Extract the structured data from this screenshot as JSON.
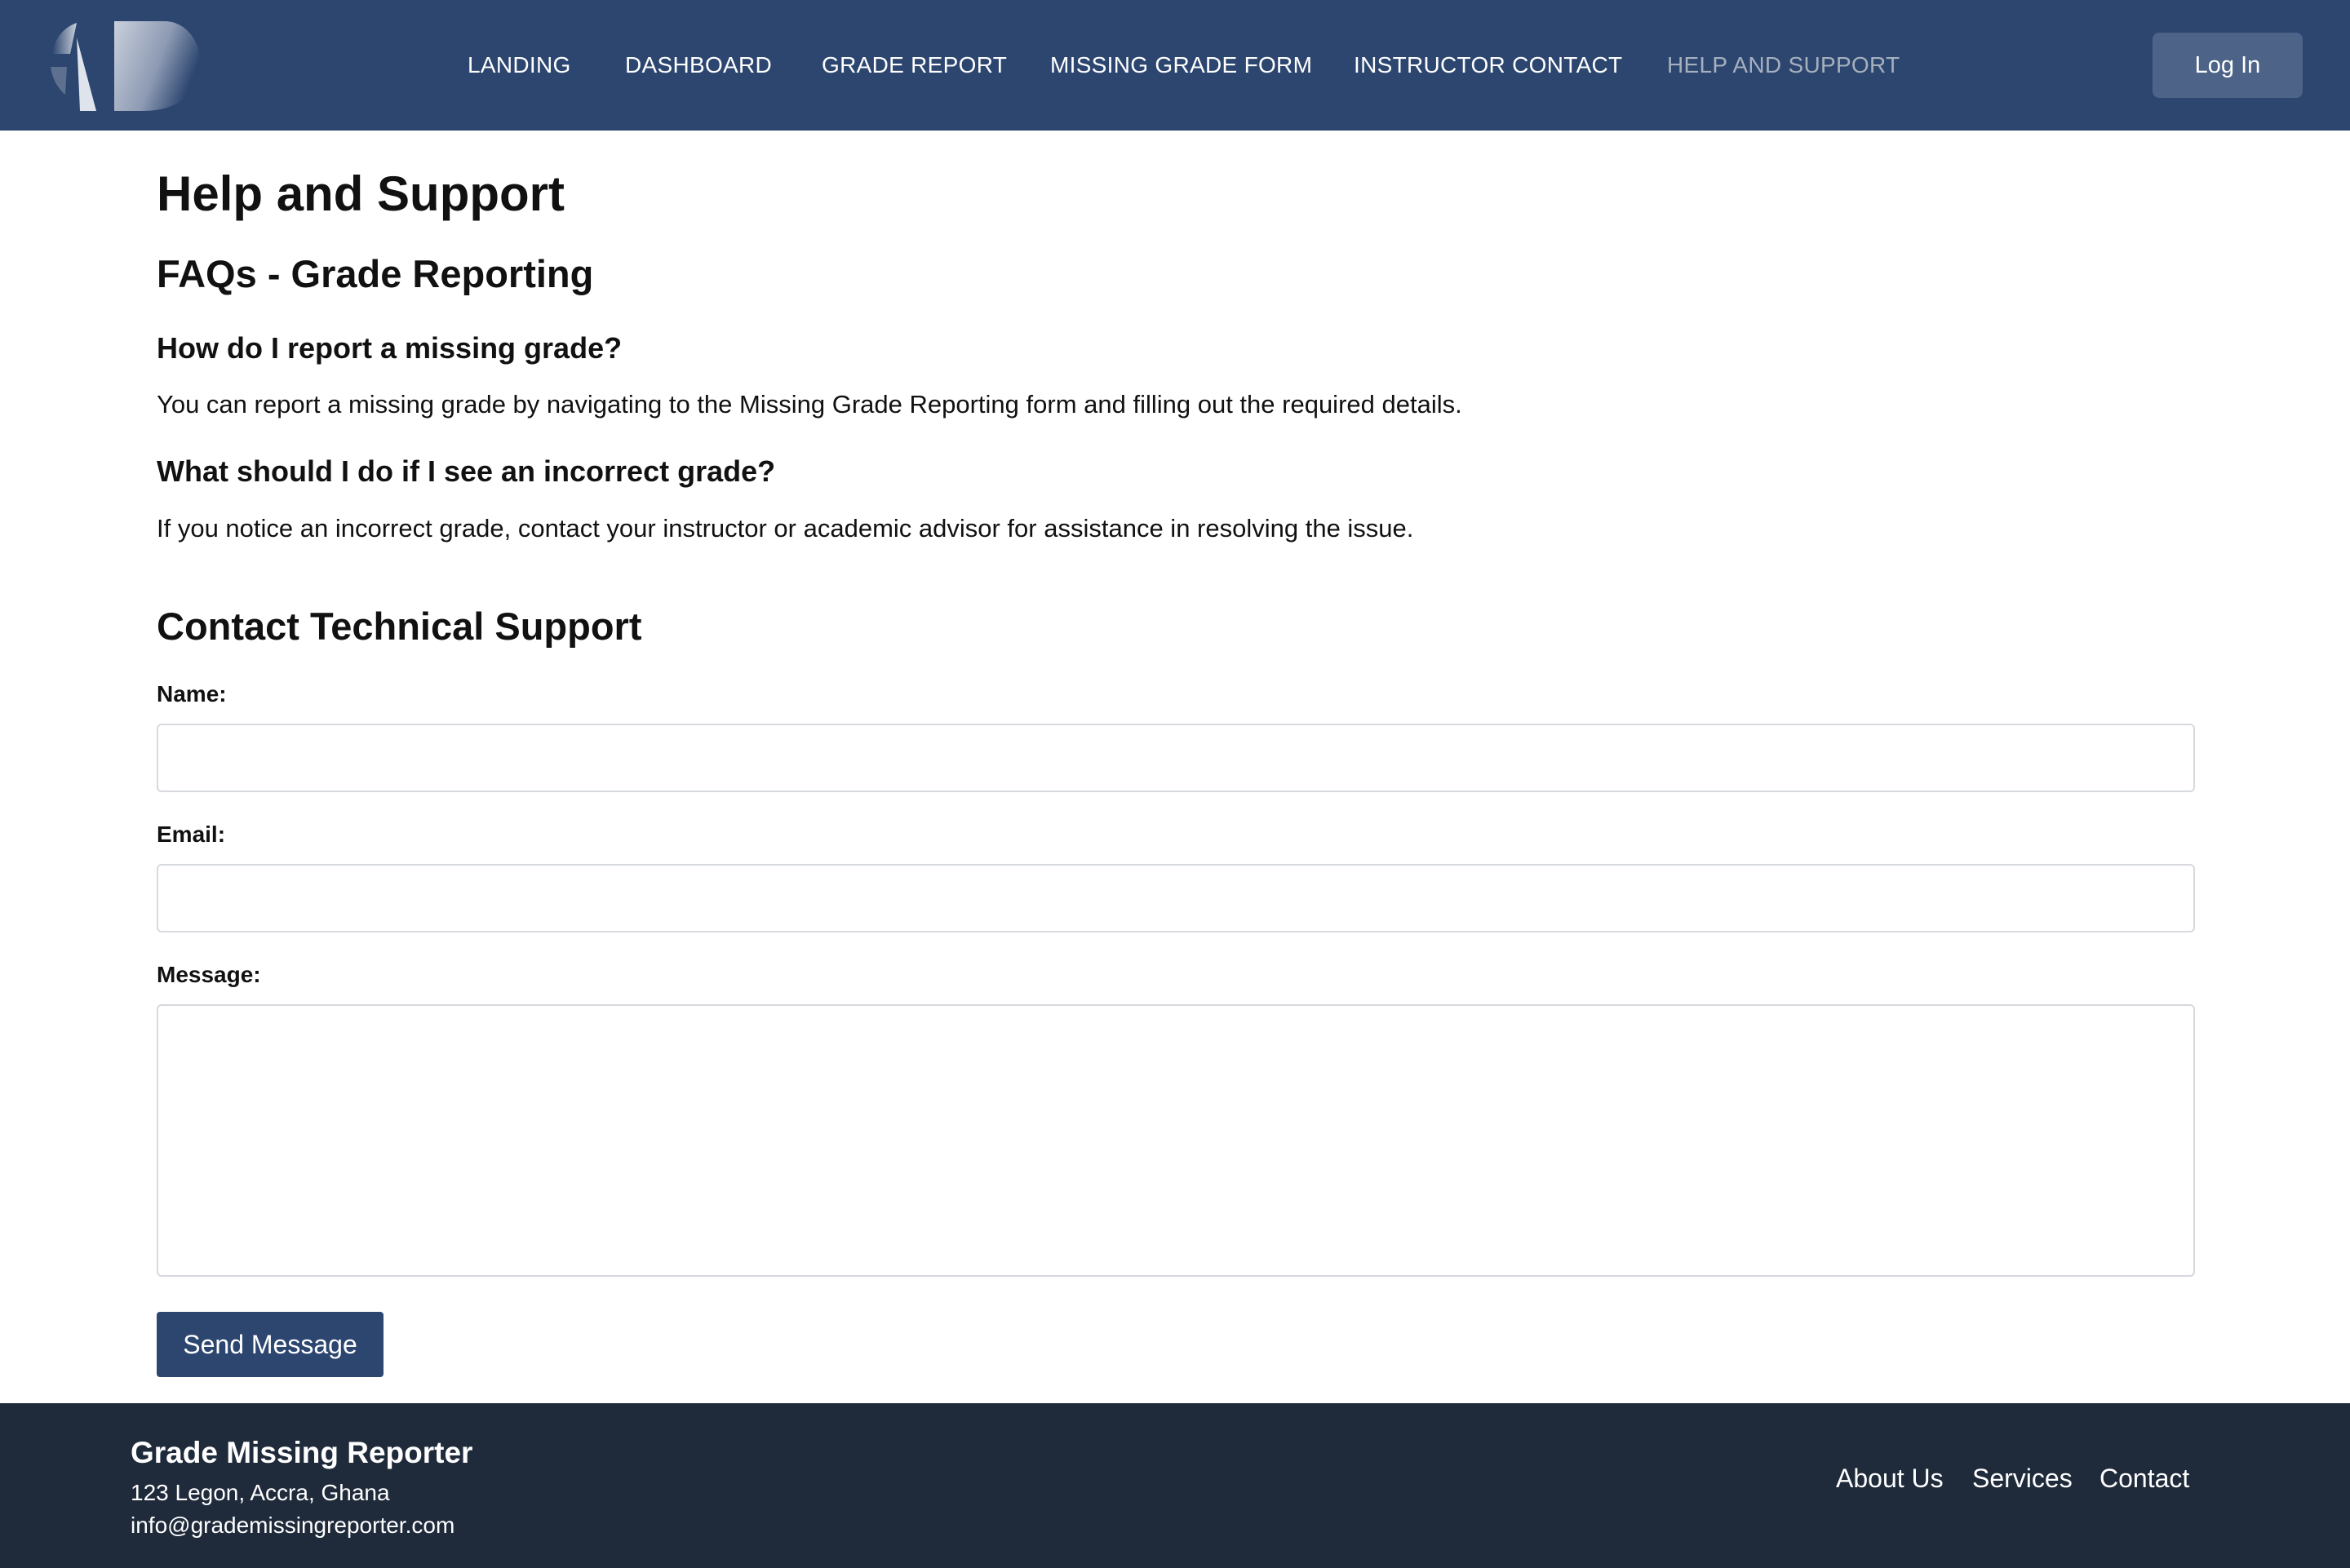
{
  "colors": {
    "header_bg": "#2c4670",
    "nav_active": "#a6afbd",
    "login_bg": "#4d6488",
    "primary_button": "#2c4670",
    "footer_bg": "#1f2a3b"
  },
  "header": {
    "logo_icon": "abstract-logo-icon",
    "nav": [
      {
        "label": "LANDING",
        "active": false
      },
      {
        "label": "DASHBOARD",
        "active": false
      },
      {
        "label": "GRADE REPORT",
        "active": false
      },
      {
        "label": "MISSING GRADE FORM",
        "active": false
      },
      {
        "label": "INSTRUCTOR CONTACT",
        "active": false
      },
      {
        "label": "HELP AND SUPPORT",
        "active": true
      }
    ],
    "login_label": "Log In"
  },
  "main": {
    "page_title": "Help and Support",
    "faq_title": "FAQs - Grade Reporting",
    "faqs": [
      {
        "question": "How do I report a missing grade?",
        "answer": "You can report a missing grade by navigating to the Missing Grade Reporting form and filling out the required details."
      },
      {
        "question": "What should I do if I see an incorrect grade?",
        "answer": "If you notice an incorrect grade, contact your instructor or academic advisor for assistance in resolving the issue."
      }
    ],
    "contact_title": "Contact Technical Support",
    "form": {
      "name_label": "Name:",
      "name_value": "",
      "email_label": "Email:",
      "email_value": "",
      "message_label": "Message:",
      "message_value": "",
      "submit_label": "Send Message"
    }
  },
  "footer": {
    "brand": "Grade Missing Reporter",
    "address": "123 Legon, Accra, Ghana",
    "email": "info@grademissingreporter.com",
    "links": [
      "About Us",
      "Services",
      "Contact"
    ]
  }
}
